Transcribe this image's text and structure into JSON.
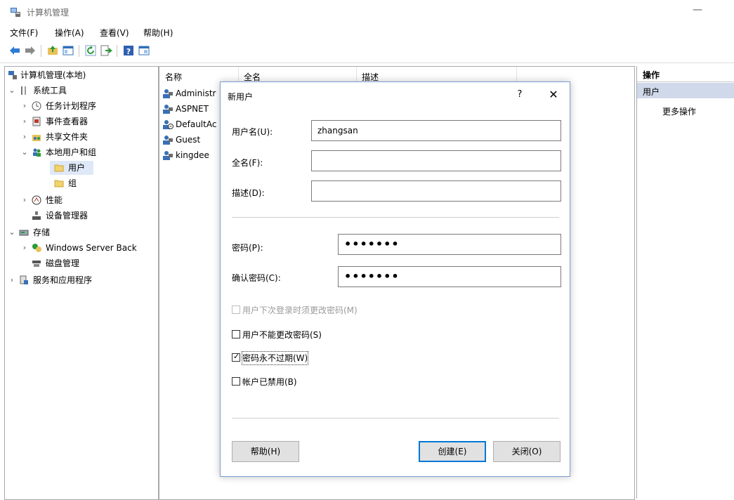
{
  "window": {
    "title": "计算机管理"
  },
  "menu": [
    "文件(F)",
    "操作(A)",
    "查看(V)",
    "帮助(H)"
  ],
  "tree": [
    {
      "label": "计算机管理(本地)",
      "icon": "computer-management-icon"
    },
    {
      "label": "系统工具",
      "icon": "tools-icon"
    },
    {
      "label": "任务计划程序",
      "icon": "clock-icon"
    },
    {
      "label": "事件查看器",
      "icon": "event-viewer-icon"
    },
    {
      "label": "共享文件夹",
      "icon": "shared-folder-icon"
    },
    {
      "label": "本地用户和组",
      "icon": "users-group-icon"
    },
    {
      "label": "用户",
      "icon": "folder-icon"
    },
    {
      "label": "组",
      "icon": "folder-icon"
    },
    {
      "label": "性能",
      "icon": "performance-icon"
    },
    {
      "label": "设备管理器",
      "icon": "device-manager-icon"
    },
    {
      "label": "存储",
      "icon": "storage-icon"
    },
    {
      "label": "Windows Server Back",
      "icon": "backup-icon"
    },
    {
      "label": "磁盘管理",
      "icon": "disk-icon"
    },
    {
      "label": "服务和应用程序",
      "icon": "services-icon"
    }
  ],
  "list": {
    "columns": [
      "名称",
      "全名",
      "描述"
    ],
    "rows": [
      "Administr",
      "ASPNET",
      "DefaultAc",
      "Guest",
      "kingdee"
    ]
  },
  "actions": {
    "header": "操作",
    "selected": "用户",
    "more": "更多操作"
  },
  "dialog": {
    "title": "新用户",
    "help_glyph": "?",
    "close_glyph": "✕",
    "username_label": "用户名(U):",
    "username_value": "zhangsan",
    "fullname_label": "全名(F):",
    "fullname_value": "",
    "desc_label": "描述(D):",
    "desc_value": "",
    "password_label": "密码(P):",
    "password_value": "•••••••",
    "confirm_label": "确认密码(C):",
    "confirm_value": "•••••••",
    "checkboxes": [
      {
        "label": "用户下次登录时须更改密码(M)",
        "checked": false,
        "disabled": true
      },
      {
        "label": "用户不能更改密码(S)",
        "checked": false,
        "disabled": false
      },
      {
        "label": "密码永不过期(W)",
        "checked": true,
        "disabled": false
      },
      {
        "label": "帐户已禁用(B)",
        "checked": false,
        "disabled": false
      }
    ],
    "help_button": "帮助(H)",
    "create_button": "创建(E)",
    "close_button": "关闭(O)"
  }
}
